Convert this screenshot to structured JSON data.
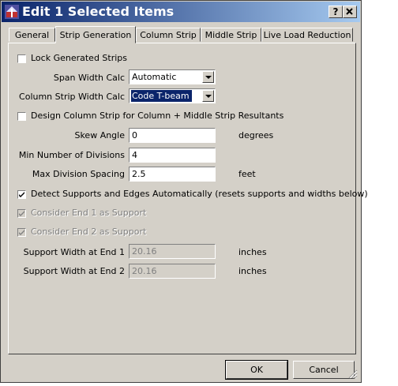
{
  "window": {
    "title": "Edit 1 Selected Items",
    "help_label": "?",
    "close_label": "X"
  },
  "tabs": [
    {
      "label": "General"
    },
    {
      "label": "Strip Generation"
    },
    {
      "label": "Column Strip"
    },
    {
      "label": "Middle Strip"
    },
    {
      "label": "Live Load Reduction"
    }
  ],
  "active_tab": "Strip Generation",
  "form": {
    "lock_generated_strips": {
      "label": "Lock Generated Strips",
      "checked": false
    },
    "span_width_calc": {
      "label": "Span Width Calc",
      "value": "Automatic"
    },
    "column_strip_width_calc": {
      "label": "Column Strip Width Calc",
      "value": "Code T-beam"
    },
    "design_column_strip": {
      "label": "Design Column Strip for Column + Middle Strip Resultants",
      "checked": false
    },
    "skew_angle": {
      "label": "Skew Angle",
      "value": "0",
      "unit": "degrees"
    },
    "min_divisions": {
      "label": "Min Number of Divisions",
      "value": "4"
    },
    "max_division_spacing": {
      "label": "Max Division Spacing",
      "value": "2.5",
      "unit": "feet"
    },
    "detect_supports": {
      "label": "Detect Supports and Edges Automatically (resets supports and widths below)",
      "checked": true
    },
    "consider_end1": {
      "label": "Consider End 1 as Support",
      "checked": true,
      "enabled": false
    },
    "consider_end2": {
      "label": "Consider End 2 as Support",
      "checked": true,
      "enabled": false
    },
    "support_width_end1": {
      "label": "Support Width at End 1",
      "value": "20.16",
      "unit": "inches"
    },
    "support_width_end2": {
      "label": "Support Width at End 2",
      "value": "20.16",
      "unit": "inches"
    }
  },
  "buttons": {
    "ok": "OK",
    "cancel": "Cancel"
  },
  "colors": {
    "title_bar_start": "#0a246a",
    "title_bar_end": "#a6caf0",
    "dialog_face": "#d4d0c8"
  },
  "icons": {
    "app": "structure-app-icon",
    "checkmark": "checkmark-icon",
    "dropdown": "chevron-down-icon"
  }
}
